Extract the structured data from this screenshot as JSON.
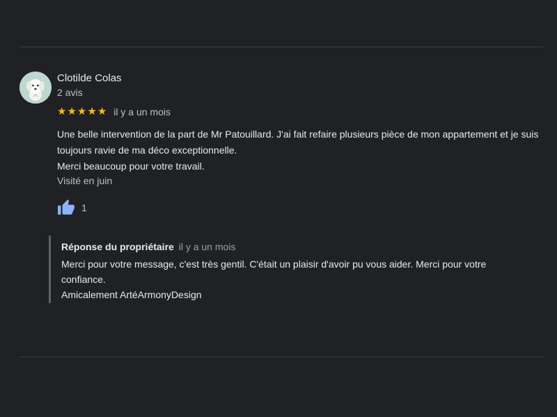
{
  "review": {
    "reviewer_name": "Clotilde Colas",
    "review_count": "2 avis",
    "rating": 5,
    "stars": [
      "★",
      "★",
      "★",
      "★",
      "★"
    ],
    "date": "il y a un mois",
    "text_lines": [
      "Une belle intervention de la part de Mr Patouillard. J'ai fait refaire plusieurs pièce de mon appartement et je suis toujours ravie de ma déco exceptionnelle.",
      "Merci beaucoup pour votre travail."
    ],
    "visited": "Visité en juin",
    "like_count": "1",
    "like_icon": "thumbs-up-icon",
    "avatar_icon": "dog-avatar-icon"
  },
  "owner_reply": {
    "title": "Réponse du propriétaire",
    "date": "il y a un mois",
    "text_lines": [
      "Merci pour votre message, c'est très gentil. C'était un plaisir d'avoir pu vous aider. Merci pour votre confiance.",
      "Amicalement ArtéArmonyDesign"
    ]
  },
  "colors": {
    "background": "#202124",
    "star": "#fbbc04",
    "thumb": "#8ab4f8",
    "avatar_bg": "#bcd8cf"
  }
}
